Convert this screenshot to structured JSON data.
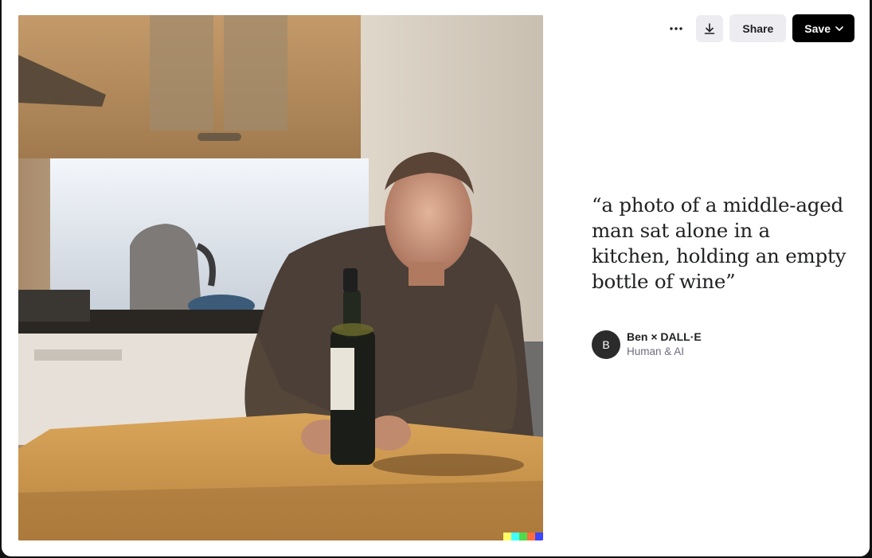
{
  "toolbar": {
    "more_icon": "ellipsis-icon",
    "download_icon": "download-icon",
    "share_label": "Share",
    "save_label": "Save",
    "save_chevron_icon": "chevron-down-icon"
  },
  "prompt": {
    "text": "“a photo of a middle-aged man sat alone in a kitchen, holding an empty bottle of wine”"
  },
  "author": {
    "avatar_initial": "B",
    "name": "Ben × DALL·E",
    "subtitle": "Human & AI"
  },
  "image": {
    "watermark_colors": [
      "#ffff66",
      "#42ffff",
      "#51da4c",
      "#ff6e3c",
      "#3c46ff"
    ]
  },
  "colors": {
    "save_bg": "#000000",
    "share_bg": "#ececf1",
    "text_primary": "#202123",
    "text_secondary": "#6e6e80"
  }
}
